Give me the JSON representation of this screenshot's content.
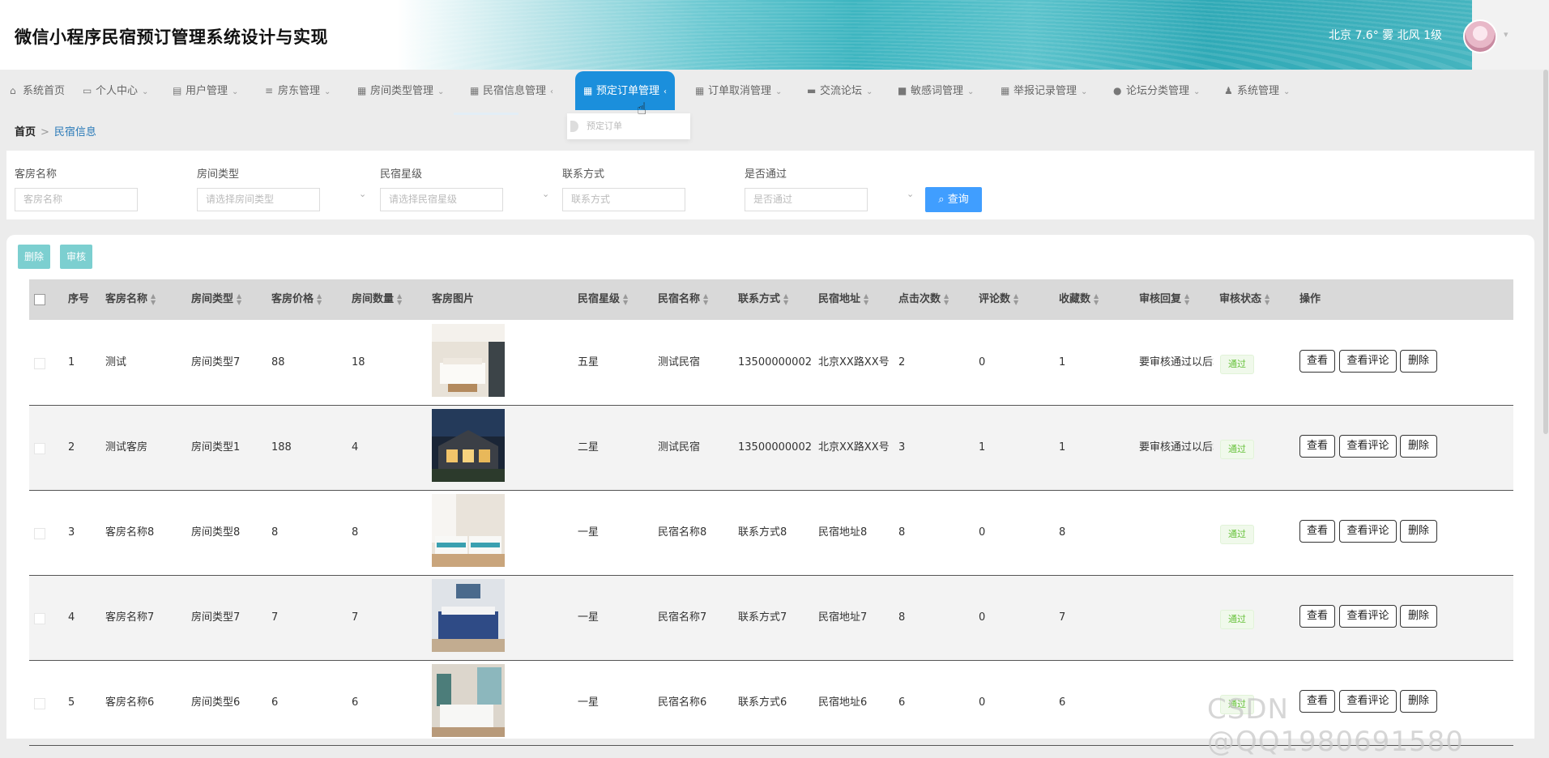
{
  "header": {
    "title": "微信小程序民宿预订管理系统设计与实现",
    "weather": "北京 7.6° 雾 北风 1级"
  },
  "nav": {
    "items": [
      {
        "label": "系统首页",
        "icon": "home-icon"
      },
      {
        "label": "个人中心",
        "icon": "card-icon"
      },
      {
        "label": "用户管理",
        "icon": "clipboard-icon"
      },
      {
        "label": "房东管理",
        "icon": "list-icon"
      },
      {
        "label": "房间类型管理",
        "icon": "grid-icon"
      },
      {
        "label": "民宿信息管理",
        "icon": "grid-icon"
      },
      {
        "label": "预定订单管理",
        "icon": "grid-icon"
      },
      {
        "label": "订单取消管理",
        "icon": "grid-icon"
      },
      {
        "label": "交流论坛",
        "icon": "printer-icon"
      },
      {
        "label": "敏感词管理",
        "icon": "chat-icon"
      },
      {
        "label": "举报记录管理",
        "icon": "grid-icon"
      },
      {
        "label": "论坛分类管理",
        "icon": "pin-icon"
      },
      {
        "label": "系统管理",
        "icon": "user-icon"
      }
    ],
    "active_index": 6,
    "dropdown_item": "预定订单"
  },
  "breadcrumb": {
    "home": "首页",
    "separator": ">",
    "current": "民宿信息"
  },
  "search": {
    "fields": [
      {
        "label": "客房名称",
        "placeholder": "客房名称"
      },
      {
        "label": "房间类型",
        "placeholder": "请选择房间类型"
      },
      {
        "label": "民宿星级",
        "placeholder": "请选择民宿星级"
      },
      {
        "label": "联系方式",
        "placeholder": "联系方式"
      },
      {
        "label": "是否通过",
        "placeholder": "是否通过"
      }
    ],
    "query_label": "查询"
  },
  "actions": {
    "delete_label": "删除",
    "audit_label": "审核"
  },
  "table": {
    "columns": [
      "序号",
      "客房名称",
      "房间类型",
      "客房价格",
      "房间数量",
      "客房图片",
      "民宿星级",
      "民宿名称",
      "联系方式",
      "民宿地址",
      "点击次数",
      "评论数",
      "收藏数",
      "审核回复",
      "审核状态",
      "操作"
    ],
    "rows": [
      {
        "no": "1",
        "room": "测试",
        "type": "房间类型7",
        "price": "88",
        "count": "18",
        "star": "五星",
        "inn": "测试民宿",
        "contact": "13500000002",
        "address": "北京XX路XX号",
        "clicks": "2",
        "comments": "0",
        "favs": "1",
        "reply": "要审核通过以后才能",
        "status": "通过"
      },
      {
        "no": "2",
        "room": "测试客房",
        "type": "房间类型1",
        "price": "188",
        "count": "4",
        "star": "二星",
        "inn": "测试民宿",
        "contact": "13500000002",
        "address": "北京XX路XX号",
        "clicks": "3",
        "comments": "1",
        "favs": "1",
        "reply": "要审核通过以后才能",
        "status": "通过"
      },
      {
        "no": "3",
        "room": "客房名称8",
        "type": "房间类型8",
        "price": "8",
        "count": "8",
        "star": "一星",
        "inn": "民宿名称8",
        "contact": "联系方式8",
        "address": "民宿地址8",
        "clicks": "8",
        "comments": "0",
        "favs": "8",
        "reply": "",
        "status": "通过"
      },
      {
        "no": "4",
        "room": "客房名称7",
        "type": "房间类型7",
        "price": "7",
        "count": "7",
        "star": "一星",
        "inn": "民宿名称7",
        "contact": "联系方式7",
        "address": "民宿地址7",
        "clicks": "8",
        "comments": "0",
        "favs": "7",
        "reply": "",
        "status": "通过"
      },
      {
        "no": "5",
        "room": "客房名称6",
        "type": "房间类型6",
        "price": "6",
        "count": "6",
        "star": "一星",
        "inn": "民宿名称6",
        "contact": "联系方式6",
        "address": "民宿地址6",
        "clicks": "6",
        "comments": "0",
        "favs": "6",
        "reply": "",
        "status": "通过"
      }
    ],
    "op_labels": {
      "view": "查看",
      "comments": "查看评论",
      "delete": "删除"
    }
  },
  "watermark": "CSDN @QQ1980691580"
}
